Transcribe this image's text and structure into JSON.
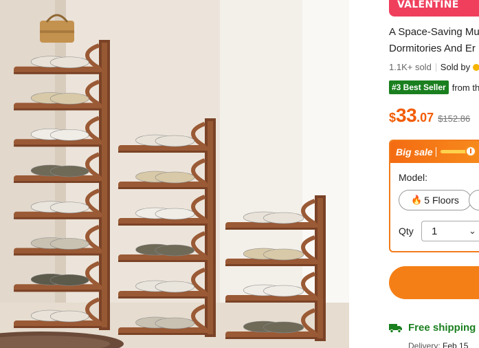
{
  "product": {
    "banner_text": "VALENTINE",
    "title_line1": "A Space-Saving Mu",
    "title_line2": "Dormitories And Er",
    "sold": "1.1K+ sold",
    "sold_by": "Sold by",
    "rank_badge": "#3 Best Seller",
    "rank_from": "from th",
    "price_currency": "$",
    "price_int": "33",
    "price_dec": ".07",
    "price_original": "$152.86"
  },
  "sale_box": {
    "label": "Big sale",
    "model_label": "Model:",
    "model_selected": "5 Floors",
    "qty_label": "Qty",
    "qty_value": "1"
  },
  "shipping": {
    "text": "Free shipping",
    "delivery_label": "Delivery:",
    "delivery_date": "Feb 15"
  },
  "colors": {
    "price": "#f25c05",
    "accent": "#f27b1a",
    "best_seller": "#1a7f1f",
    "banner": "#ef3f5d"
  }
}
